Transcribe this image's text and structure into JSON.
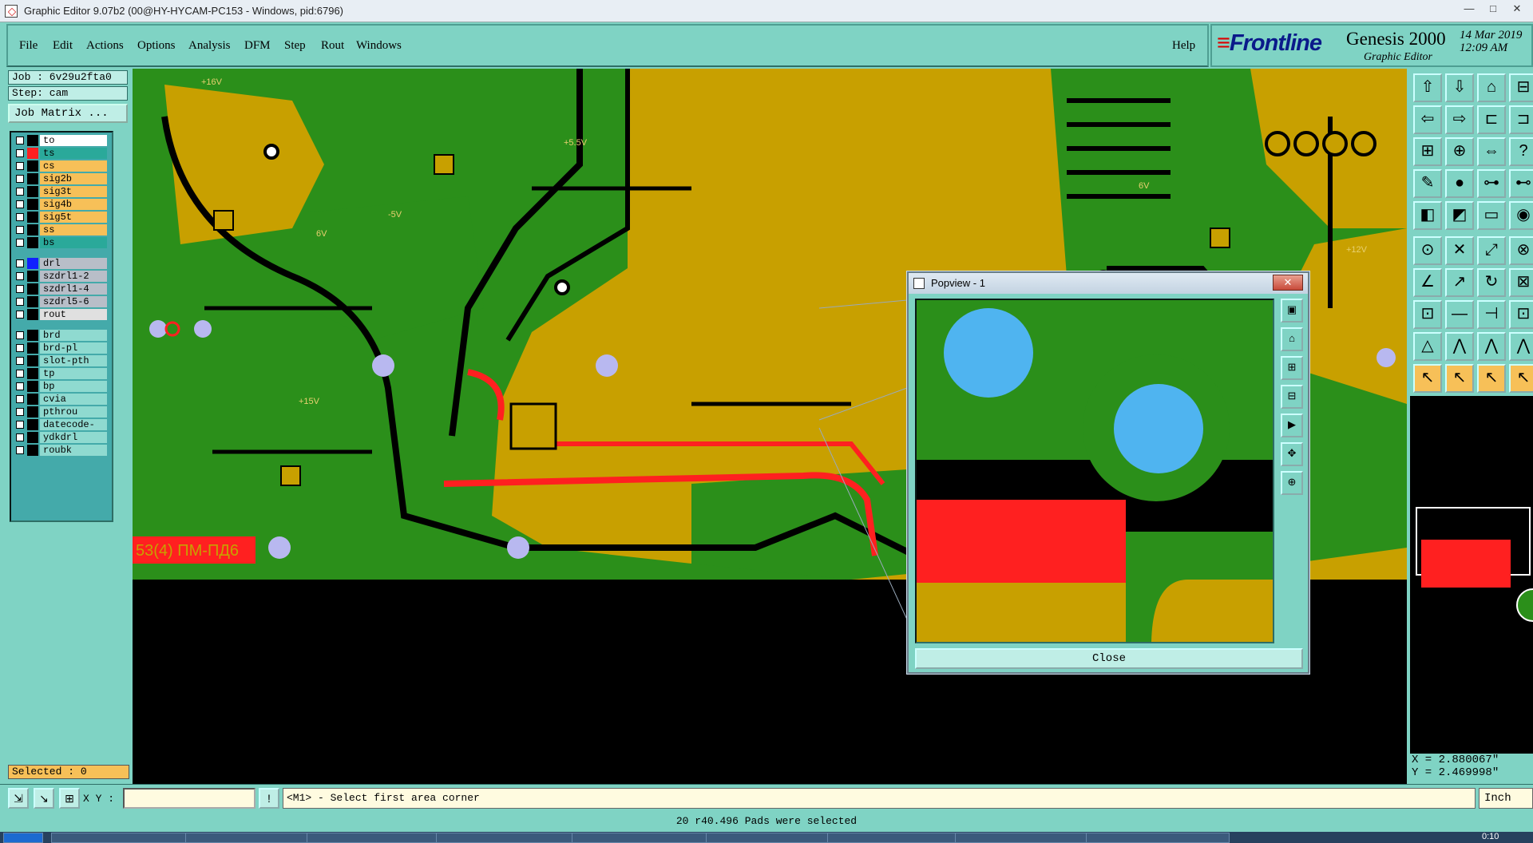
{
  "window": {
    "title": "Graphic Editor 9.07b2 (00@HY-HYCAM-PC153 - Windows, pid:6796)"
  },
  "menu": [
    "File",
    "Edit",
    "Actions",
    "Options",
    "Analysis",
    "DFM",
    "Step",
    "Rout",
    "Windows"
  ],
  "help_label": "Help",
  "brand": {
    "logo": "Frontline",
    "product": "Genesis 2000",
    "subtitle": "Graphic Editor",
    "date": "14 Mar 2019",
    "time": "12:09 AM"
  },
  "job": {
    "job_text": "Job : 6v29u2fta0",
    "step_text": "Step: cam",
    "matrix_label": "Job Matrix ..."
  },
  "layers": [
    {
      "name": "to",
      "color": "#000000",
      "bg": "#ffffff"
    },
    {
      "name": "ts",
      "color": "#ff2020",
      "bg": "#2aa99a"
    },
    {
      "name": "cs",
      "color": "#000000",
      "bg": "#f7c058"
    },
    {
      "name": "sig2b",
      "color": "#000000",
      "bg": "#f7c058"
    },
    {
      "name": "sig3t",
      "color": "#000000",
      "bg": "#f7c058"
    },
    {
      "name": "sig4b",
      "color": "#000000",
      "bg": "#f7c058"
    },
    {
      "name": "sig5t",
      "color": "#000000",
      "bg": "#f7c058"
    },
    {
      "name": "ss",
      "color": "#000000",
      "bg": "#f7c058"
    },
    {
      "name": "bs",
      "color": "#000000",
      "bg": "#2aa99a"
    },
    {
      "name": "drl",
      "color": "#1020ff",
      "bg": "#b8bec8"
    },
    {
      "name": "szdrl1-2",
      "color": "#000000",
      "bg": "#b8bec8"
    },
    {
      "name": "szdrl1-4",
      "color": "#000000",
      "bg": "#b8bec8"
    },
    {
      "name": "szdrl5-6",
      "color": "#000000",
      "bg": "#b8bec8"
    },
    {
      "name": "rout",
      "color": "#000000",
      "bg": "#e0e0e0"
    },
    {
      "name": "brd",
      "color": "#000000",
      "bg": "#8fdad0"
    },
    {
      "name": "brd-pl",
      "color": "#000000",
      "bg": "#8fdad0"
    },
    {
      "name": "slot-pth",
      "color": "#000000",
      "bg": "#8fdad0"
    },
    {
      "name": "tp",
      "color": "#000000",
      "bg": "#8fdad0"
    },
    {
      "name": "bp",
      "color": "#000000",
      "bg": "#8fdad0"
    },
    {
      "name": "cvia",
      "color": "#000000",
      "bg": "#8fdad0"
    },
    {
      "name": "pthrou",
      "color": "#000000",
      "bg": "#8fdad0"
    },
    {
      "name": "datecode-pte",
      "color": "#000000",
      "bg": "#8fdad0"
    },
    {
      "name": "ydkdrl",
      "color": "#000000",
      "bg": "#8fdad0"
    },
    {
      "name": "roubk",
      "color": "#000000",
      "bg": "#8fdad0"
    }
  ],
  "selected_text": "Selected : 0",
  "board": {
    "silk_text": "53(4) ПМ-ПД6",
    "labels": [
      "+16V",
      "+5.5V",
      "-5V",
      "6V",
      "+15V",
      "6V",
      "+12V"
    ]
  },
  "popup": {
    "title": "Popview - 1",
    "close_label": "Close"
  },
  "coords": {
    "x": "X = 2.880067\"",
    "y": "Y = 2.469998\""
  },
  "bottom": {
    "xy_label": "X Y :",
    "xy_value": "",
    "prompt": "<M1> - Select first area corner",
    "unit": "Inch"
  },
  "status": "20 r40.496 Pads were selected",
  "taskbar": {
    "clock": "0:10"
  },
  "colors": {
    "copper": "#2b8f1a",
    "board": "#c8a000",
    "trace": "#000000",
    "highlight": "#ff2020",
    "drill": "#4fb4f0"
  }
}
